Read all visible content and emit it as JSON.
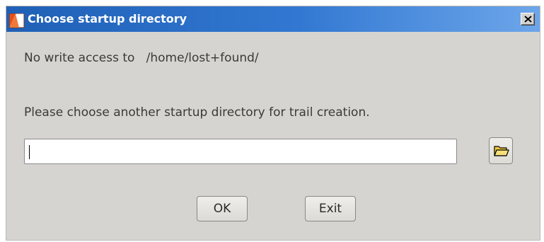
{
  "window": {
    "title": "Choose startup directory",
    "close_label": "Close"
  },
  "message": {
    "no_access_prefix": "No write access to",
    "path": "/home/lost+found/",
    "instruction": "Please choose another startup directory for trail creation."
  },
  "directory_input": {
    "value": "",
    "placeholder": ""
  },
  "buttons": {
    "ok_label": "OK",
    "exit_label": "Exit"
  },
  "icons": {
    "title": "app-window-icon",
    "close": "close-icon",
    "browse": "folder-icon"
  },
  "colors": {
    "titlebar_start": "#1f60b6",
    "titlebar_end": "#6da6ea",
    "dialog_bg": "#d6d4d0",
    "folder_yellow": "#f5d94a"
  }
}
